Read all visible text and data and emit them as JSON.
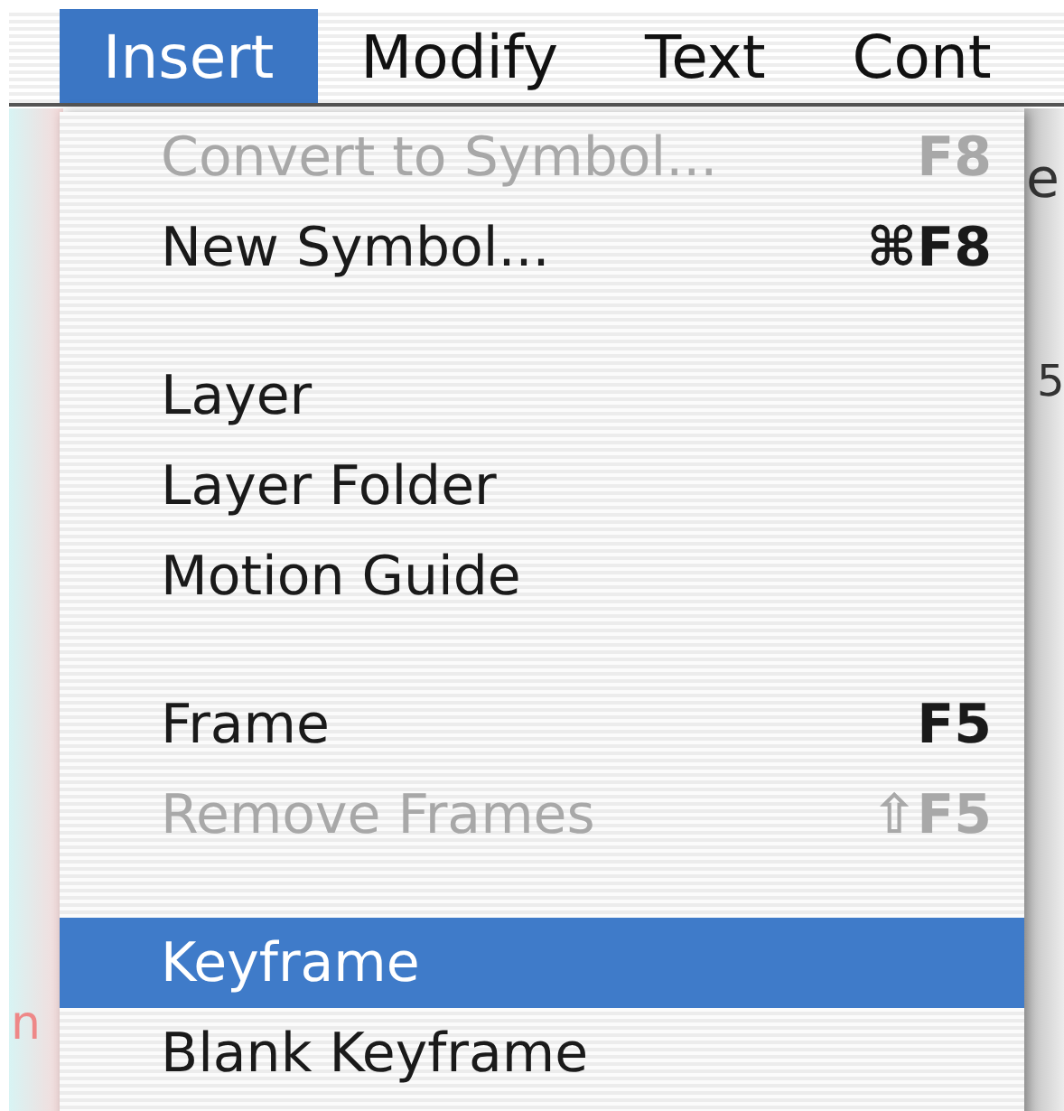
{
  "menu_bar": [
    {
      "label": "Insert",
      "selected": true
    },
    {
      "label": "Modify",
      "selected": false
    },
    {
      "label": "Text",
      "selected": false
    },
    {
      "label": "Cont",
      "selected": false
    }
  ],
  "menu": {
    "items": [
      {
        "kind": "item",
        "label": "Convert to Symbol...",
        "shortcut": "F8",
        "disabled": true,
        "selected": false
      },
      {
        "kind": "item",
        "label": "New Symbol...",
        "shortcut": "⌘F8",
        "disabled": false,
        "selected": false
      },
      {
        "kind": "separator"
      },
      {
        "kind": "item",
        "label": "Layer",
        "disabled": false,
        "selected": false
      },
      {
        "kind": "item",
        "label": "Layer Folder",
        "disabled": false,
        "selected": false
      },
      {
        "kind": "item",
        "label": "Motion Guide",
        "disabled": false,
        "selected": false
      },
      {
        "kind": "separator"
      },
      {
        "kind": "item",
        "label": "Frame",
        "shortcut": "F5",
        "disabled": false,
        "selected": false
      },
      {
        "kind": "item",
        "label": "Remove Frames",
        "shortcut": "⇧F5",
        "disabled": true,
        "selected": false
      },
      {
        "kind": "separator"
      },
      {
        "kind": "item",
        "label": "Keyframe",
        "disabled": false,
        "selected": true
      },
      {
        "kind": "item",
        "label": "Blank Keyframe",
        "disabled": false,
        "selected": false
      }
    ]
  },
  "background_text": [
    {
      "text": "e"
    },
    {
      "text": "5"
    },
    {
      "text": "n"
    }
  ]
}
